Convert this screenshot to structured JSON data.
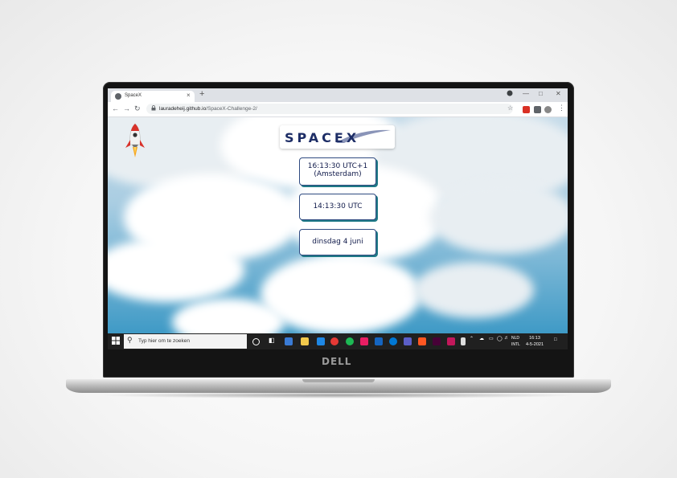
{
  "browser": {
    "tab_title": "SpaceX",
    "tab_close": "×",
    "new_tab": "+",
    "url_host": "lauradeheij.github.io",
    "url_path": "/SpaceX-Challenge-2/",
    "lock_icon": "lock-icon"
  },
  "page": {
    "logo": "SPACEX",
    "local_time_line1": "16:13:30 UTC+1",
    "local_time_line2": "(Amsterdam)",
    "utc_time": "14:13:30 UTC",
    "date": "dinsdag 4 juni"
  },
  "taskbar": {
    "search_placeholder": "Typ hier om te zoeken",
    "lang_top": "NLD",
    "lang_bottom": "INTL",
    "time": "16:13",
    "date": "4-5-2021"
  },
  "bezel": {
    "brand": "DELL"
  },
  "colors": {
    "accent": "#1d2d66",
    "box_shadow": "#1f7a86",
    "taskbar": "#202020"
  }
}
